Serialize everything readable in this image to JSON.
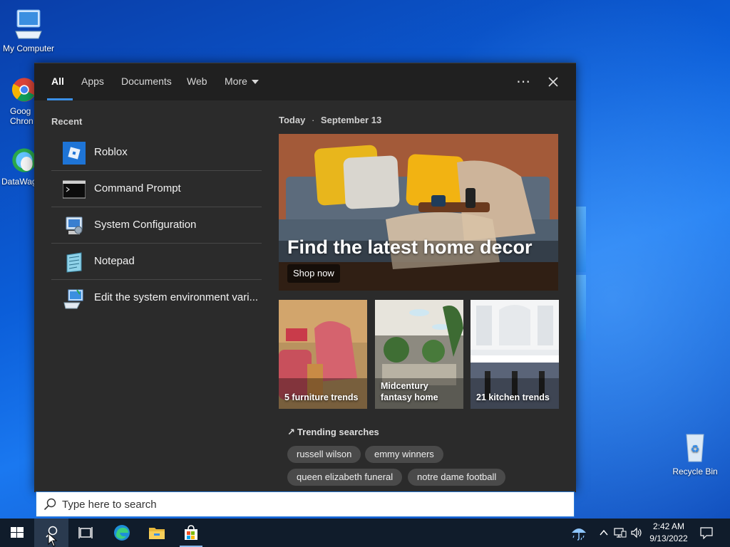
{
  "desktop": {
    "icons": [
      {
        "label": "My Computer"
      },
      {
        "label": "Goog\nChron"
      },
      {
        "label": "DataWag"
      },
      {
        "label": "Recycle Bin"
      }
    ]
  },
  "search_panel": {
    "tabs": [
      {
        "label": "All",
        "active": true
      },
      {
        "label": "Apps"
      },
      {
        "label": "Documents"
      },
      {
        "label": "Web"
      },
      {
        "label": "More"
      }
    ],
    "options_icon": "ellipsis-icon",
    "close_icon": "close-icon",
    "recent": {
      "heading": "Recent",
      "items": [
        {
          "label": "Roblox",
          "icon": "roblox-icon"
        },
        {
          "label": "Command Prompt",
          "icon": "command-prompt-icon"
        },
        {
          "label": "System Configuration",
          "icon": "system-configuration-icon"
        },
        {
          "label": "Notepad",
          "icon": "notepad-icon"
        },
        {
          "label": "Edit the system environment vari...",
          "icon": "computer-settings-icon"
        }
      ]
    },
    "today": {
      "label": "Today",
      "separator": "·",
      "date": "September 13",
      "hero": {
        "title": "Find the latest home decor",
        "cta": "Shop now"
      },
      "cards": [
        {
          "caption": "5 furniture trends"
        },
        {
          "caption": "Midcentury fantasy home"
        },
        {
          "caption": "21 kitchen trends"
        }
      ]
    },
    "trending": {
      "heading": "Trending searches",
      "chips": [
        "russell wilson",
        "emmy winners",
        "queen elizabeth funeral",
        "notre dame football"
      ]
    }
  },
  "search_box": {
    "placeholder": "Type here to search",
    "value": ""
  },
  "taskbar": {
    "pinned": [
      "start-icon",
      "search-icon",
      "task-view-icon",
      "edge-icon",
      "file-explorer-icon",
      "store-icon"
    ],
    "tray": [
      "weather-icon",
      "chevron-up-icon",
      "network-icon",
      "volume-icon",
      "notification-icon"
    ],
    "time": "2:42 AM",
    "date": "9/13/2022"
  },
  "colors": {
    "accent": "#3a8fe6",
    "panel": "#2b2b2b",
    "taskbar": "#101c2b"
  }
}
